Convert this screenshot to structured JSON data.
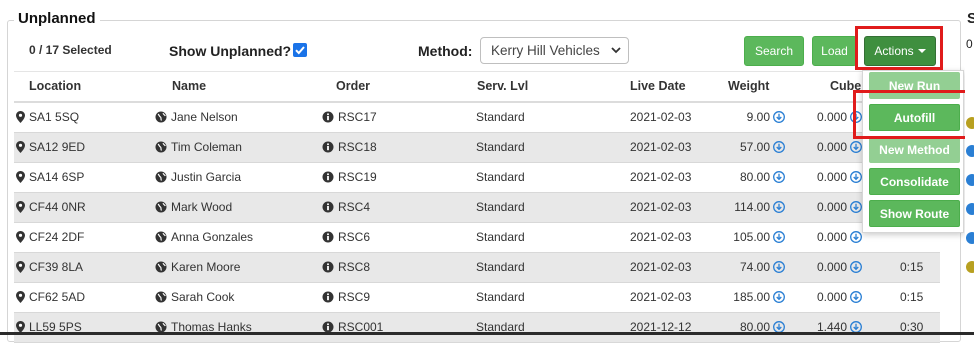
{
  "panel": {
    "title": "Unplanned",
    "selected_text": "0 / 17 Selected",
    "show_unplanned_label": "Show Unplanned?",
    "show_unplanned_checked": true,
    "method_label": "Method:",
    "method_value": "Kerry Hill Vehicles"
  },
  "toolbar": {
    "search_label": "Search",
    "load_label": "Load",
    "actions_label": "Actions"
  },
  "columns": [
    "Location",
    "Name",
    "Order",
    "Serv. Lvl",
    "Live Date",
    "Weight",
    "Cube"
  ],
  "rows": [
    {
      "location": "SA1 5SQ",
      "name": "Jane Nelson",
      "order": "RSC17",
      "serv": "Standard",
      "date": "2021-02-03",
      "weight": "9.00",
      "cube": "0.000",
      "time": ""
    },
    {
      "location": "SA12 9ED",
      "name": "Tim Coleman",
      "order": "RSC18",
      "serv": "Standard",
      "date": "2021-02-03",
      "weight": "57.00",
      "cube": "0.000",
      "time": ""
    },
    {
      "location": "SA14 6SP",
      "name": "Justin Garcia",
      "order": "RSC19",
      "serv": "Standard",
      "date": "2021-02-03",
      "weight": "80.00",
      "cube": "0.000",
      "time": ""
    },
    {
      "location": "CF44 0NR",
      "name": "Mark Wood",
      "order": "RSC4",
      "serv": "Standard",
      "date": "2021-02-03",
      "weight": "114.00",
      "cube": "0.000",
      "time": ""
    },
    {
      "location": "CF24 2DF",
      "name": "Anna Gonzales",
      "order": "RSC6",
      "serv": "Standard",
      "date": "2021-02-03",
      "weight": "105.00",
      "cube": "0.000",
      "time": ""
    },
    {
      "location": "CF39 8LA",
      "name": "Karen Moore",
      "order": "RSC8",
      "serv": "Standard",
      "date": "2021-02-03",
      "weight": "74.00",
      "cube": "0.000",
      "time": "0:15"
    },
    {
      "location": "CF62 5AD",
      "name": "Sarah Cook",
      "order": "RSC9",
      "serv": "Standard",
      "date": "2021-02-03",
      "weight": "185.00",
      "cube": "0.000",
      "time": "0:15"
    },
    {
      "location": "LL59 5PS",
      "name": "Thomas Hanks",
      "order": "RSC001",
      "serv": "Standard",
      "date": "2021-12-12",
      "weight": "80.00",
      "cube": "1.440",
      "time": "0:30"
    }
  ],
  "actions_menu": [
    {
      "label": "New Run",
      "disabled": true
    },
    {
      "label": "Autofill",
      "disabled": false
    },
    {
      "label": "New Method",
      "disabled": true
    },
    {
      "label": "Consolidate",
      "disabled": false
    },
    {
      "label": "Show Route",
      "disabled": false
    }
  ],
  "right_panel": {
    "title_fragment": "S",
    "count_fragment": "0"
  },
  "colors": {
    "green": "#5cb85c",
    "dark_green": "#3f8f3f",
    "highlight": "#e01b1b",
    "checkbox": "#1a73e8"
  }
}
